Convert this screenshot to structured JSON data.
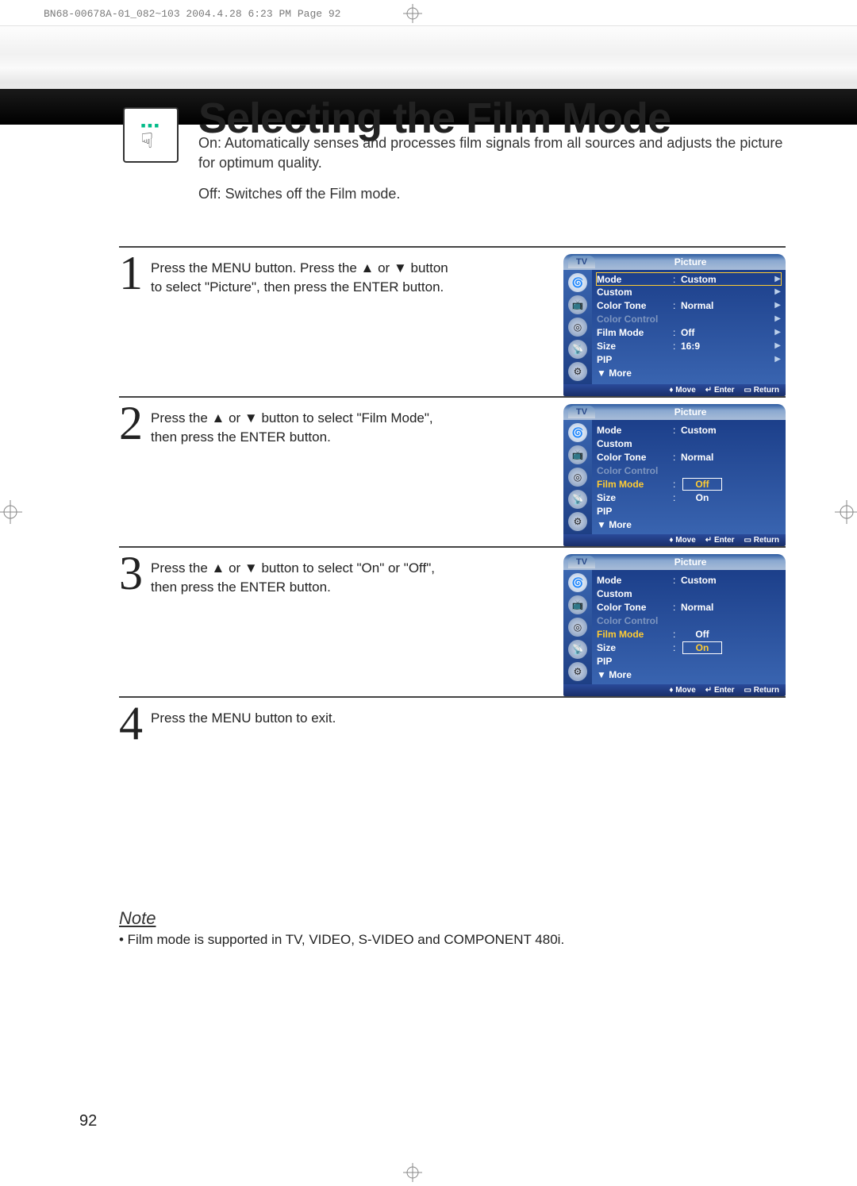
{
  "meta": {
    "header_line": "BN68-00678A-01_082~103  2004.4.28  6:23 PM  Page 92"
  },
  "title": "Selecting the Film Mode",
  "intro_on": "On: Automatically senses and processes film signals from all sources and adjusts the picture for optimum quality.",
  "intro_off": "Off: Switches off the Film mode.",
  "steps": {
    "s1": {
      "num": "1",
      "text": "Press the MENU button. Press the ▲ or ▼ button to select \"Picture\", then press the ENTER button."
    },
    "s2": {
      "num": "2",
      "text": "Press the ▲ or ▼ button to select \"Film Mode\", then press the ENTER button."
    },
    "s3": {
      "num": "3",
      "text": "Press the ▲ or ▼ button to select \"On\" or \"Off\", then press the ENTER button."
    },
    "s4": {
      "num": "4",
      "text": "Press the MENU button to exit."
    }
  },
  "osd": {
    "tab": "TV",
    "title": "Picture",
    "rows": {
      "mode": {
        "label": "Mode",
        "val": "Custom"
      },
      "custom": {
        "label": "Custom"
      },
      "colortone": {
        "label": "Color Tone",
        "val": "Normal"
      },
      "colorctrl": {
        "label": "Color Control"
      },
      "filmmode": {
        "label": "Film Mode",
        "val": "Off"
      },
      "size": {
        "label": "Size",
        "val": "16:9"
      },
      "pip": {
        "label": "PIP"
      },
      "more": {
        "label": "▼ More"
      }
    },
    "options": {
      "off": "Off",
      "on": "On"
    },
    "footer": {
      "move": "Move",
      "enter": "Enter",
      "ret": "Return"
    }
  },
  "note": {
    "head": "Note",
    "text": "•  Film mode is supported in TV, VIDEO, S-VIDEO and COMPONENT 480i."
  },
  "pagenum": "92"
}
